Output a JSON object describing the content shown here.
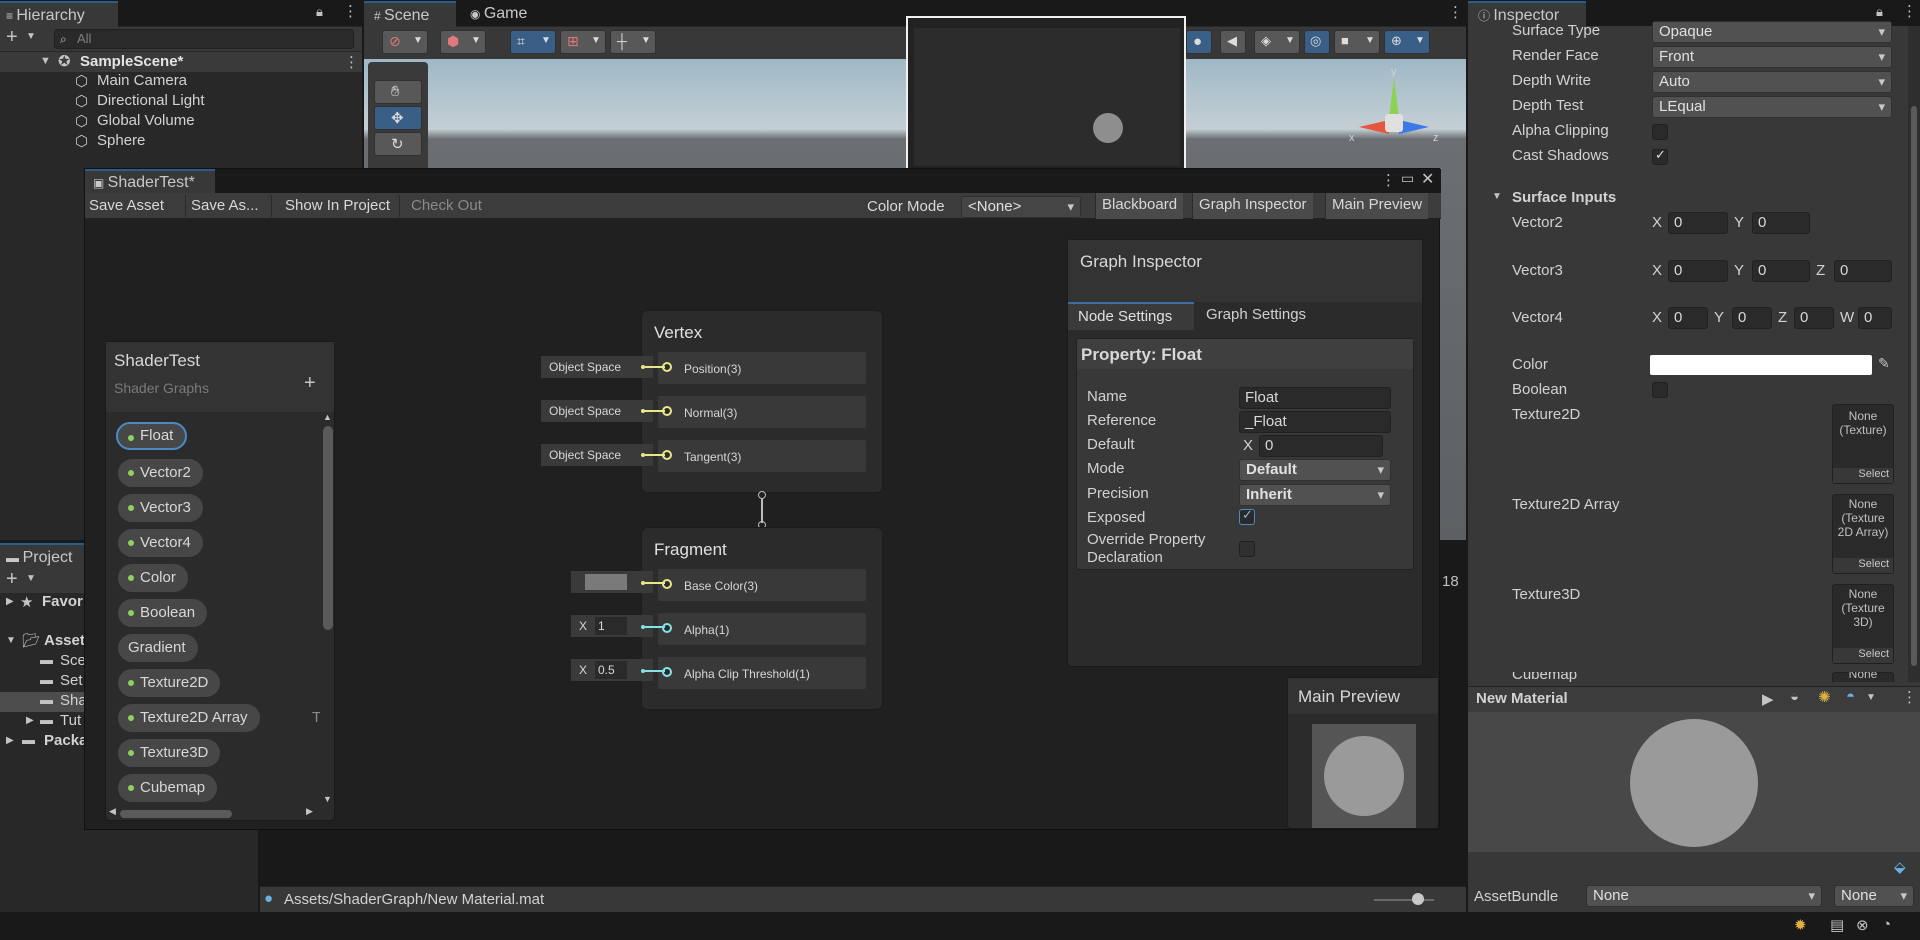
{
  "hierarchy": {
    "tab_label": "Hierarchy",
    "search_placeholder": "All",
    "scene_name": "SampleScene*",
    "items": [
      "Main Camera",
      "Directional Light",
      "Global Volume",
      "Sphere"
    ]
  },
  "scene_tabs": {
    "scene": "Scene",
    "game": "Game"
  },
  "project": {
    "tab_label": "Project",
    "favorites": "Favor",
    "assets": "Asset",
    "folders": [
      "Sce",
      "Set",
      "Sha",
      "Tut"
    ],
    "packages": "Packa"
  },
  "shader_window": {
    "title": "ShaderTest*",
    "toolbar": {
      "save_asset": "Save Asset",
      "save_as": "Save As...",
      "show_in_project": "Show In Project",
      "check_out": "Check Out",
      "color_mode_label": "Color Mode",
      "color_mode_value": "<None>",
      "blackboard": "Blackboard",
      "graph_inspector": "Graph Inspector",
      "main_preview": "Main Preview"
    },
    "blackboard": {
      "title": "ShaderTest",
      "subtitle": "Shader Graphs",
      "add": "+",
      "properties": [
        "Float",
        "Vector2",
        "Vector3",
        "Vector4",
        "Color",
        "Boolean",
        "Gradient",
        "Texture2D",
        "Texture2D Array",
        "Texture3D",
        "Cubemap"
      ],
      "overflow_text": "Te"
    },
    "vertex": {
      "title": "Vertex",
      "slots": [
        {
          "input": "Object Space",
          "label": "Position(3)"
        },
        {
          "input": "Object Space",
          "label": "Normal(3)"
        },
        {
          "input": "Object Space",
          "label": "Tangent(3)"
        }
      ]
    },
    "fragment": {
      "title": "Fragment",
      "slots": [
        {
          "label": "Base Color(3)",
          "input_color": "#7a7a7a"
        },
        {
          "label": "Alpha(1)",
          "x_label": "X",
          "value": "1"
        },
        {
          "label": "Alpha Clip Threshold(1)",
          "x_label": "X",
          "value": "0.5"
        }
      ]
    },
    "graph_inspector": {
      "title": "Graph Inspector",
      "tabs": [
        "Node Settings",
        "Graph Settings"
      ],
      "property_header": "Property: Float",
      "fields": {
        "name_label": "Name",
        "name_value": "Float",
        "reference_label": "Reference",
        "reference_value": "_Float",
        "default_label": "Default",
        "default_x": "X",
        "default_value": "0",
        "mode_label": "Mode",
        "mode_value": "Default",
        "precision_label": "Precision",
        "precision_value": "Inherit",
        "exposed_label": "Exposed",
        "override_label_1": "Override Property",
        "override_label_2": "Declaration"
      }
    },
    "main_preview": {
      "title": "Main Preview"
    },
    "fps_overflow": "18"
  },
  "inspector": {
    "tab_label": "Inspector",
    "rows": [
      {
        "label": "Surface Type",
        "value": "Opaque"
      },
      {
        "label": "Render Face",
        "value": "Front"
      },
      {
        "label": "Depth Write",
        "value": "Auto"
      },
      {
        "label": "Depth Test",
        "value": "LEqual"
      }
    ],
    "alpha_clipping": "Alpha Clipping",
    "cast_shadows": "Cast Shadows",
    "surface_inputs": "Surface Inputs",
    "vector2": {
      "label": "Vector2",
      "x": "0",
      "y": "0"
    },
    "vector3": {
      "label": "Vector3",
      "x": "0",
      "y": "0",
      "z": "0"
    },
    "vector4": {
      "label": "Vector4",
      "x": "0",
      "y": "0",
      "z": "0",
      "w": "0"
    },
    "color_label": "Color",
    "boolean_label": "Boolean",
    "textures": [
      {
        "label": "Texture2D",
        "slot_text": "None\n(Texture)",
        "select": "Select"
      },
      {
        "label": "Texture2D Array",
        "slot_text": "None\n(Texture\n2D Array)",
        "select": "Select"
      },
      {
        "label": "Texture3D",
        "slot_text": "None\n(Texture\n3D)",
        "select": "Select"
      },
      {
        "label": "Cubemap",
        "slot_text": "None",
        "select": ""
      }
    ],
    "axis": {
      "x": "X",
      "y": "Y",
      "z": "Z",
      "w": "W"
    },
    "preview_title": "New Material",
    "assetbundle_label": "AssetBundle",
    "assetbundle_value": "None",
    "assetbundle_variant": "None"
  },
  "status_bar": {
    "path": "Assets/ShaderGraph/New Material.mat"
  },
  "colors": {
    "accent": "#2c5d87",
    "port_yellow": "#e8e889",
    "port_blue": "#84e4e7",
    "prop_dot": "#8fd15f"
  }
}
